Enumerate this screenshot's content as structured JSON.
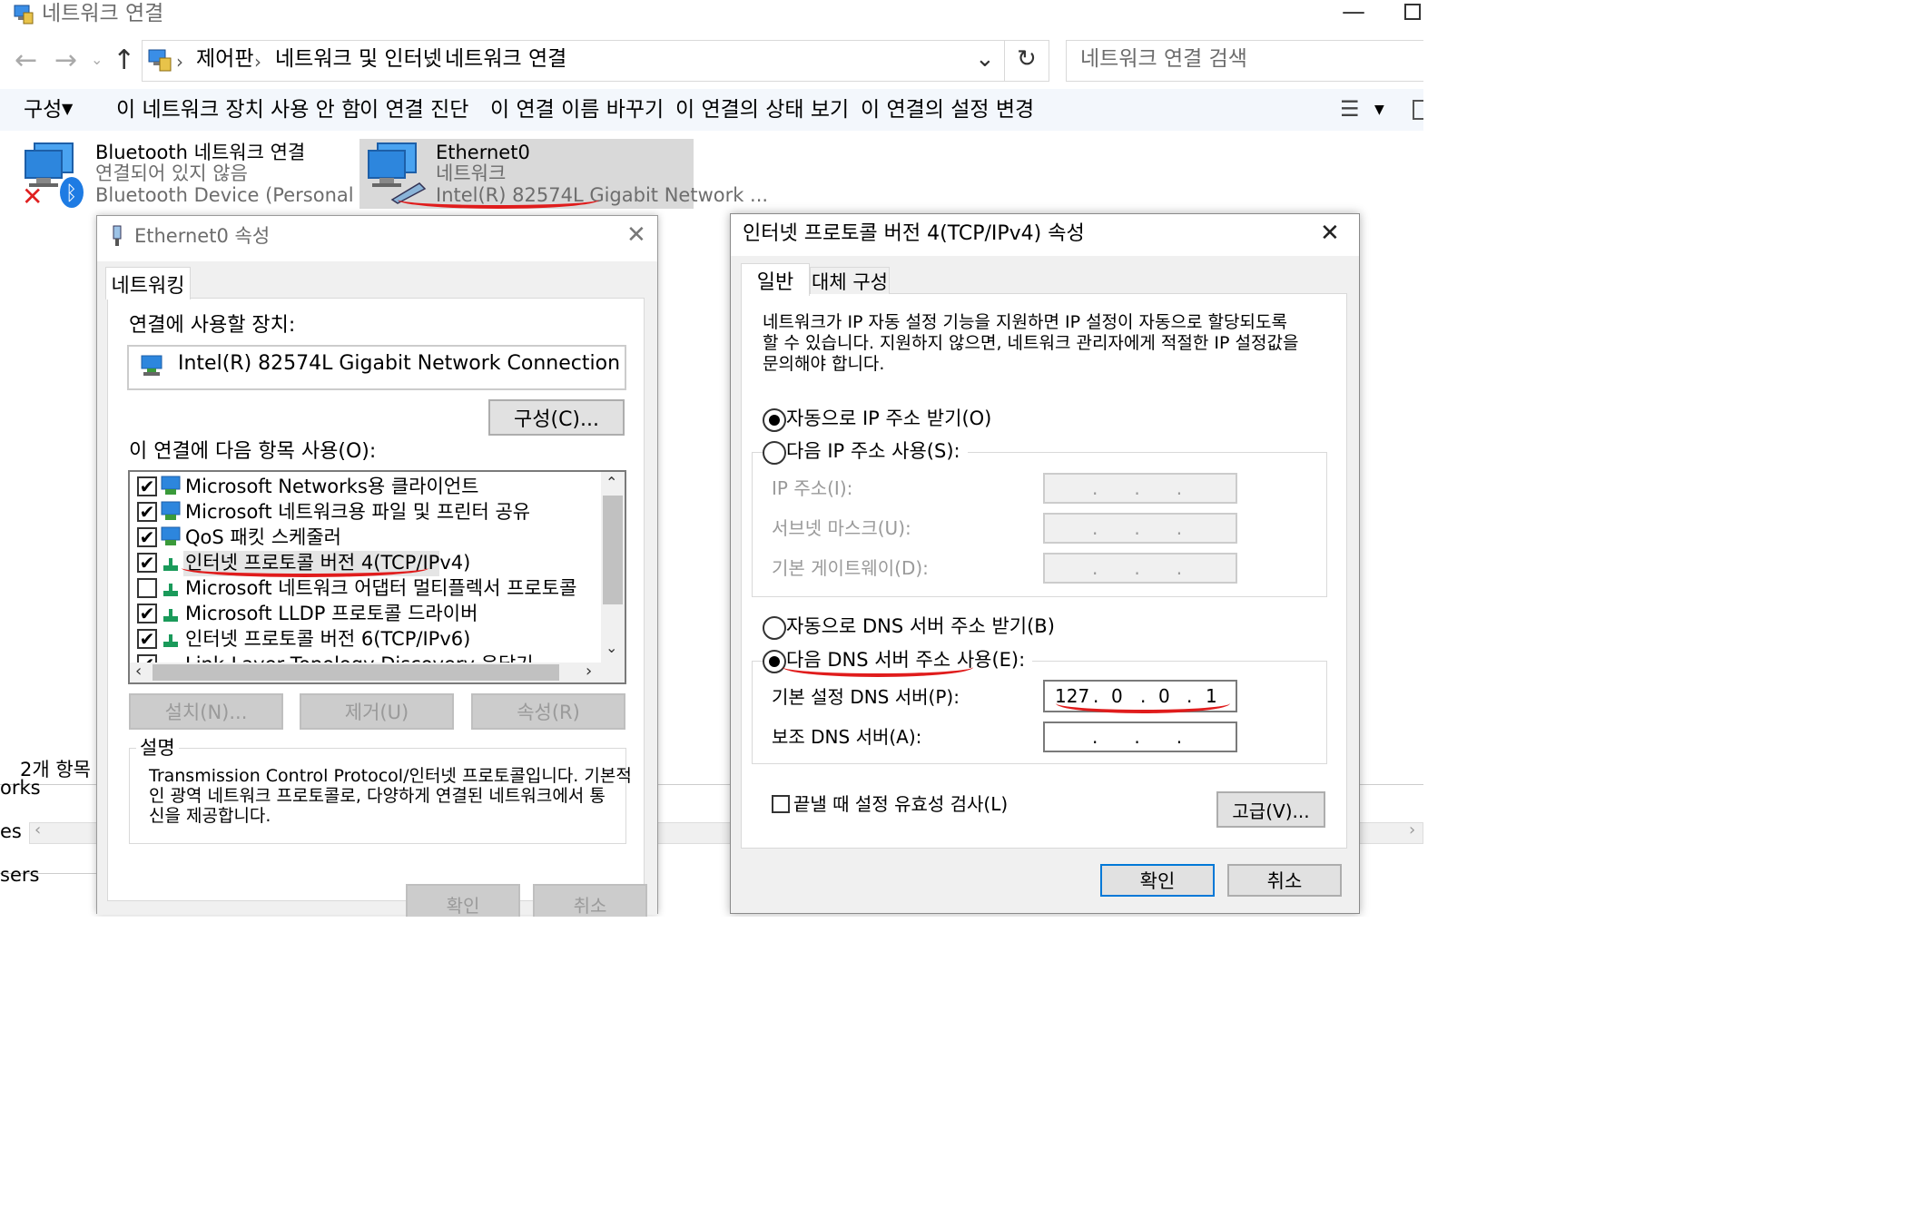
{
  "window": {
    "title": "네트워크 연결"
  },
  "addressbar": {
    "breadcrumb": [
      "제어판",
      "네트워크 및 인터넷",
      "네트워크 연결"
    ],
    "search_placeholder": "네트워크 연결 검색"
  },
  "toolbar": {
    "organize": "구성",
    "items": [
      "이 네트워크 장치 사용 안 함",
      "이 연결 진단",
      "이 연결 이름 바꾸기",
      "이 연결의 상태 보기",
      "이 연결의 설정 변경"
    ]
  },
  "connections": [
    {
      "name": "Bluetooth 네트워크 연결",
      "status": "연결되어 있지 않음",
      "device": "Bluetooth Device (Personal Area ..."
    },
    {
      "name": "Ethernet0",
      "status": "네트워크",
      "device": "Intel(R) 82574L Gigabit Network ..."
    }
  ],
  "statusbar": {
    "count": "2개 항목",
    "side_labels": [
      "orks",
      "es",
      "sers"
    ]
  },
  "eth_props": {
    "title": "Ethernet0 속성",
    "tab": "네트워킹",
    "connect_using_label": "연결에 사용할 장치:",
    "adapter": "Intel(R) 82574L Gigabit Network Connection",
    "configure_btn": "구성(C)...",
    "items_label": "이 연결에 다음 항목 사용(O):",
    "items": [
      {
        "label": "Microsoft Networks용 클라이언트",
        "checked": true
      },
      {
        "label": "Microsoft 네트워크용 파일 및 프린터 공유",
        "checked": true
      },
      {
        "label": "QoS 패킷 스케줄러",
        "checked": true
      },
      {
        "label": "인터넷 프로토콜 버전 4(TCP/IPv4)",
        "checked": true
      },
      {
        "label": "Microsoft 네트워크 어댑터 멀티플렉서 프로토콜",
        "checked": false
      },
      {
        "label": "Microsoft LLDP 프로토콜 드라이버",
        "checked": true
      },
      {
        "label": "인터넷 프로토콜 버전 6(TCP/IPv6)",
        "checked": true
      },
      {
        "label": "Link-Layer Topology Discovery 응답기",
        "checked": true
      }
    ],
    "install_btn": "설치(N)...",
    "remove_btn": "제거(U)",
    "props_btn": "속성(R)",
    "desc_label": "설명",
    "desc_text": [
      "Transmission Control Protocol/인터넷 프로토콜입니다. 기본적",
      "인 광역 네트워크 프로토콜로, 다양하게 연결된 네트워크에서 통",
      "신을 제공합니다."
    ],
    "ok_btn": "확인",
    "cancel_btn": "취소"
  },
  "ipv4_props": {
    "title": "인터넷 프로토콜 버전 4(TCP/IPv4) 속성",
    "tab_general": "일반",
    "tab_alt": "대체 구성",
    "intro": [
      "네트워크가 IP 자동 설정 기능을 지원하면 IP 설정이 자동으로 할당되도록",
      "할 수 있습니다. 지원하지 않으면, 네트워크 관리자에게 적절한 IP 설정값을",
      "문의해야 합니다."
    ],
    "auto_ip": "자동으로 IP 주소 받기(O)",
    "manual_ip": "다음 IP 주소 사용(S):",
    "ip_label": "IP 주소(I):",
    "subnet_label": "서브넷 마스크(U):",
    "gateway_label": "기본 게이트웨이(D):",
    "auto_dns": "자동으로 DNS 서버 주소 받기(B)",
    "manual_dns": "다음 DNS 서버 주소 사용(E):",
    "preferred_dns_label": "기본 설정 DNS 서버(P):",
    "preferred_dns": [
      "127",
      "0",
      "0",
      "1"
    ],
    "alt_dns_label": "보조 DNS 서버(A):",
    "validate": "끝낼 때 설정 유효성 검사(L)",
    "advanced_btn": "고급(V)...",
    "ok_btn": "확인",
    "cancel_btn": "취소"
  }
}
